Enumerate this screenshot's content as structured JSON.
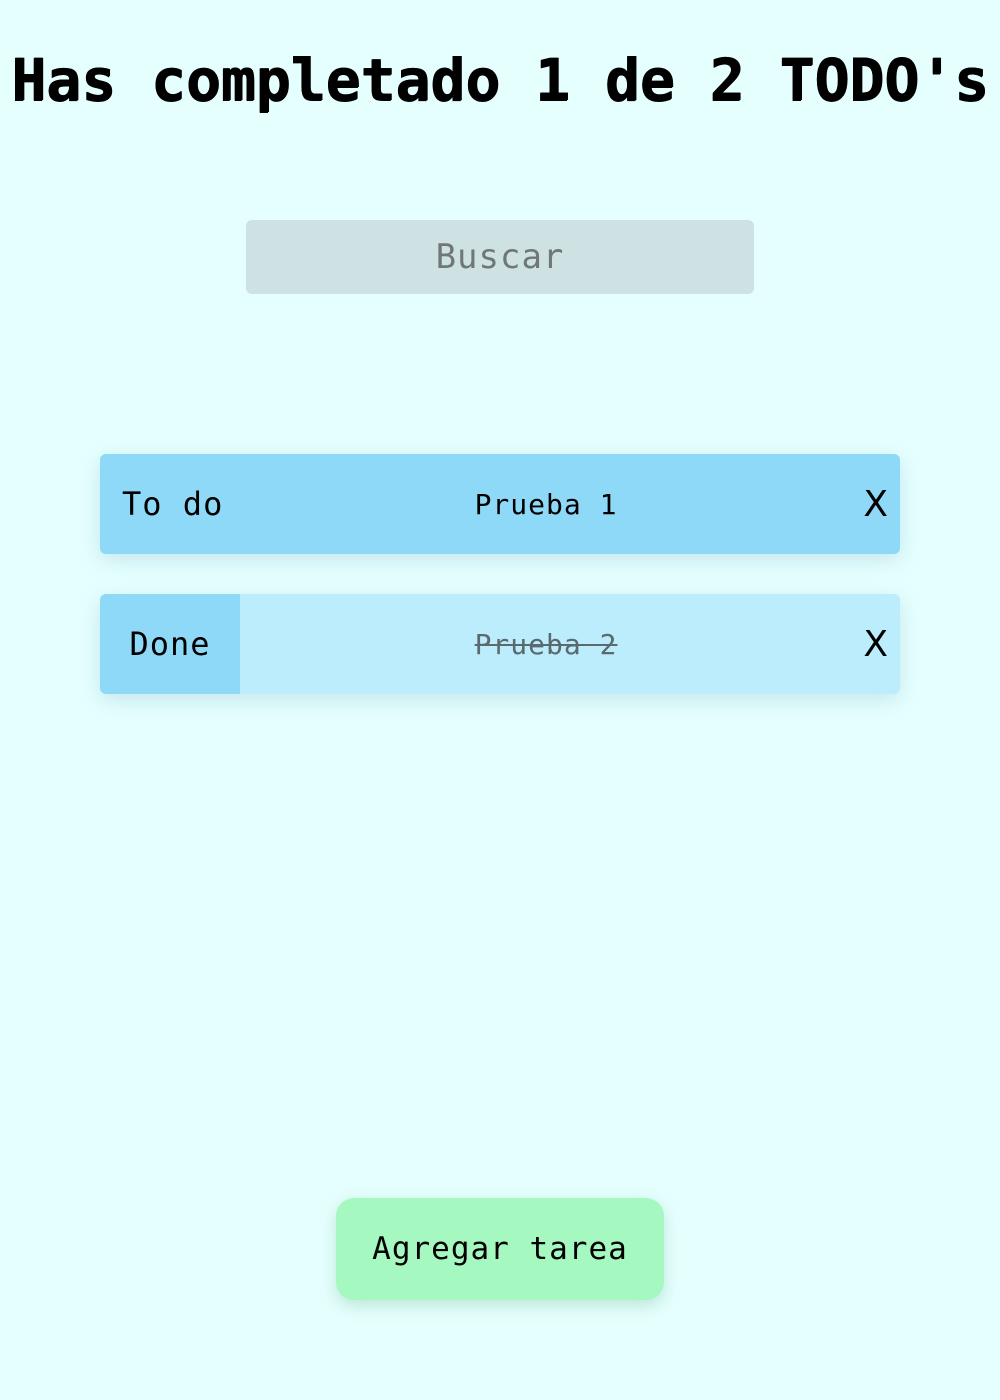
{
  "header": {
    "title": "Has completado 1 de 2 TODO's"
  },
  "search": {
    "placeholder": "Buscar",
    "value": ""
  },
  "todos": [
    {
      "status_label": "To do",
      "text": "Prueba 1",
      "delete_label": "X",
      "completed": false
    },
    {
      "status_label": "Done",
      "text": "Prueba 2",
      "delete_label": "X",
      "completed": true
    }
  ],
  "footer": {
    "add_label": "Agregar tarea"
  },
  "colors": {
    "background": "#e5fffe",
    "item_pending": "#8ed9f8",
    "item_completed": "#bbedfc",
    "search_bg": "#cfe2e3",
    "add_button": "#a6f8c1"
  }
}
